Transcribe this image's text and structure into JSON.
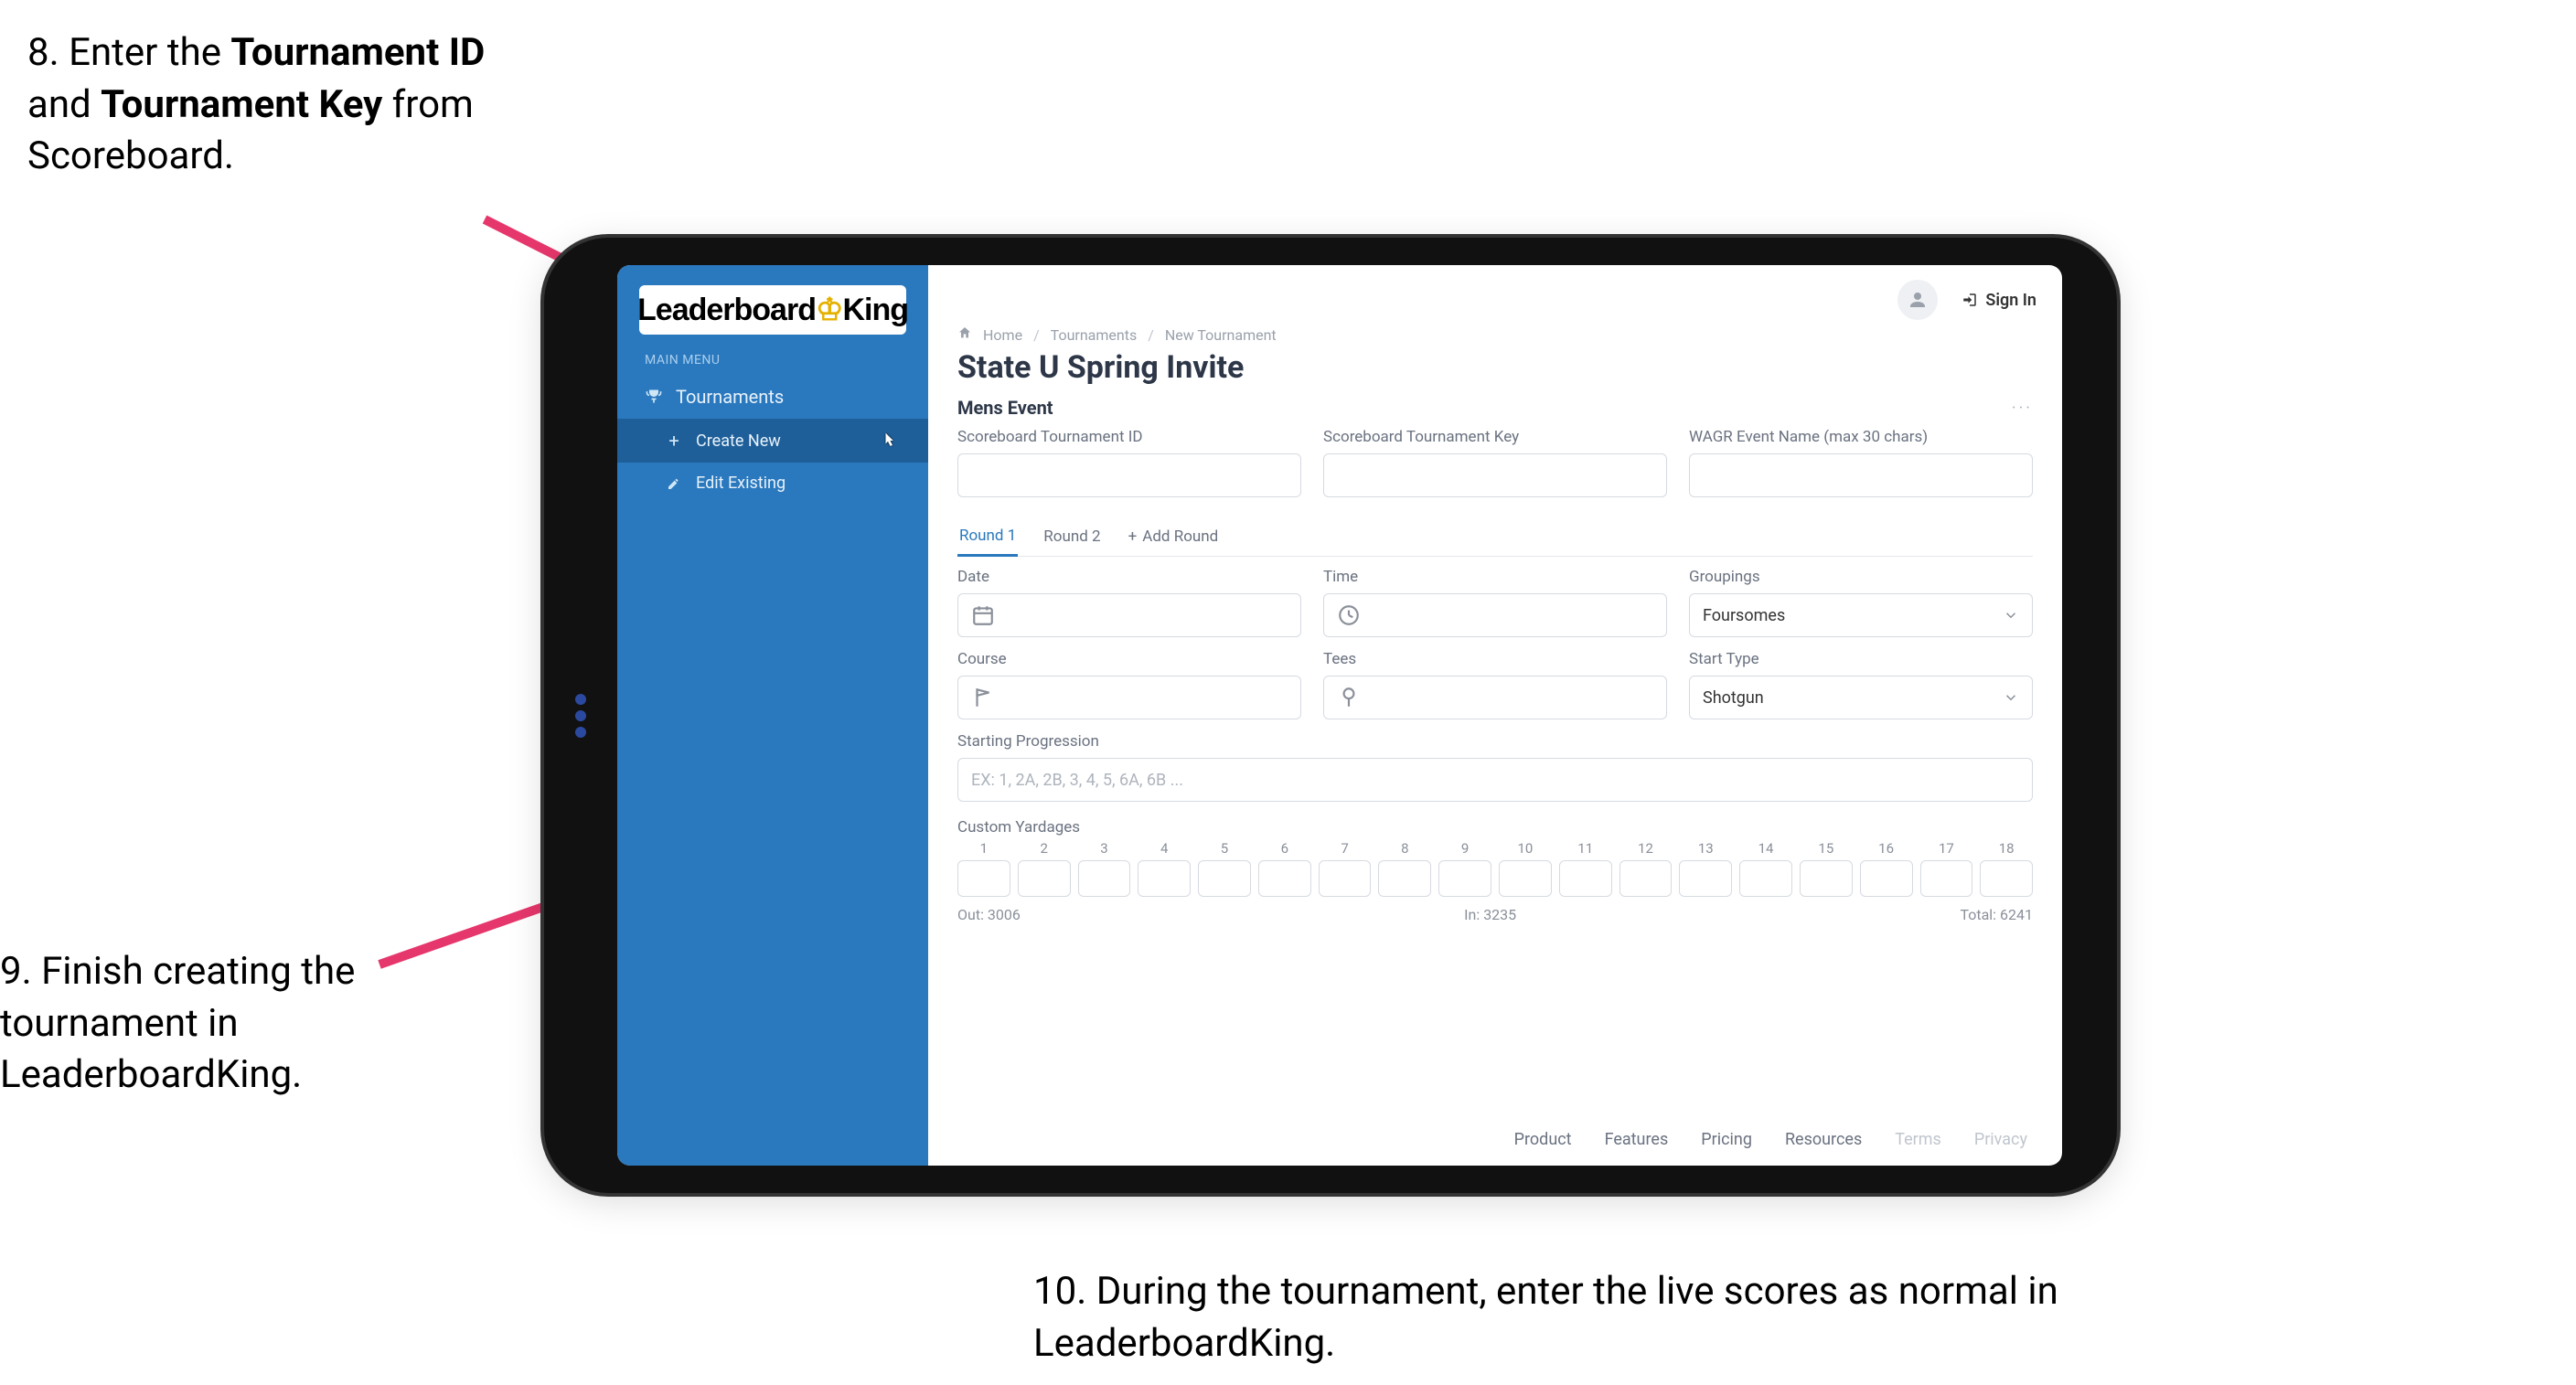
{
  "annotations": {
    "step8_a": "8. Enter the ",
    "step8_b1": "Tournament ID",
    "step8_c": " and ",
    "step8_b2": "Tournament Key",
    "step8_d": " from Scoreboard.",
    "step9": "9. Finish creating the tournament in LeaderboardKing.",
    "step10": "10. During the tournament, enter the live scores as normal in LeaderboardKing."
  },
  "sidebar": {
    "logo_part1": "Leaderboard",
    "logo_part2": "King",
    "menu_label": "MAIN MENU",
    "tournaments": "Tournaments",
    "create_new": "Create New",
    "edit_existing": "Edit Existing"
  },
  "topbar": {
    "sign_in": "Sign In"
  },
  "breadcrumb": {
    "home": "Home",
    "tournaments": "Tournaments",
    "new_tournament": "New Tournament"
  },
  "page": {
    "title": "State U Spring Invite",
    "section": "Mens Event",
    "labels": {
      "tid": "Scoreboard Tournament ID",
      "tkey": "Scoreboard Tournament Key",
      "wagr": "WAGR Event Name (max 30 chars)",
      "date": "Date",
      "time": "Time",
      "groupings": "Groupings",
      "course": "Course",
      "tees": "Tees",
      "start_type": "Start Type",
      "starting_prog": "Starting Progression",
      "starting_prog_ph": "EX: 1, 2A, 2B, 3, 4, 5, 6A, 6B ...",
      "custom_yardages": "Custom Yardages"
    },
    "values": {
      "groupings": "Foursomes",
      "start_type": "Shotgun"
    },
    "tabs": {
      "r1": "Round 1",
      "r2": "Round 2",
      "add": "Add Round"
    },
    "holes": [
      "1",
      "2",
      "3",
      "4",
      "5",
      "6",
      "7",
      "8",
      "9",
      "10",
      "11",
      "12",
      "13",
      "14",
      "15",
      "16",
      "17",
      "18"
    ],
    "yardage_summary": {
      "out_label": "Out:",
      "out_val": "3006",
      "in_label": "In:",
      "in_val": "3235",
      "total_label": "Total:",
      "total_val": "6241"
    }
  },
  "footer": {
    "product": "Product",
    "features": "Features",
    "pricing": "Pricing",
    "resources": "Resources",
    "terms": "Terms",
    "privacy": "Privacy"
  }
}
